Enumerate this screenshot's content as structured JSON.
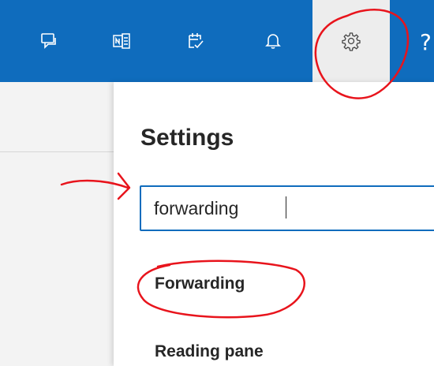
{
  "toolbar": {
    "icons": [
      {
        "name": "chat-icon"
      },
      {
        "name": "onenote-icon"
      },
      {
        "name": "calendar-check-icon"
      },
      {
        "name": "bell-icon"
      },
      {
        "name": "gear-icon"
      }
    ],
    "help_label": "?"
  },
  "settings": {
    "title": "Settings",
    "search_value": "forwarding",
    "results": [
      {
        "label": "Forwarding"
      },
      {
        "label": "Reading pane"
      }
    ]
  },
  "colors": {
    "topbar": "#0f6cbd",
    "active_tab": "#ededed",
    "annotation": "#e8141c"
  }
}
